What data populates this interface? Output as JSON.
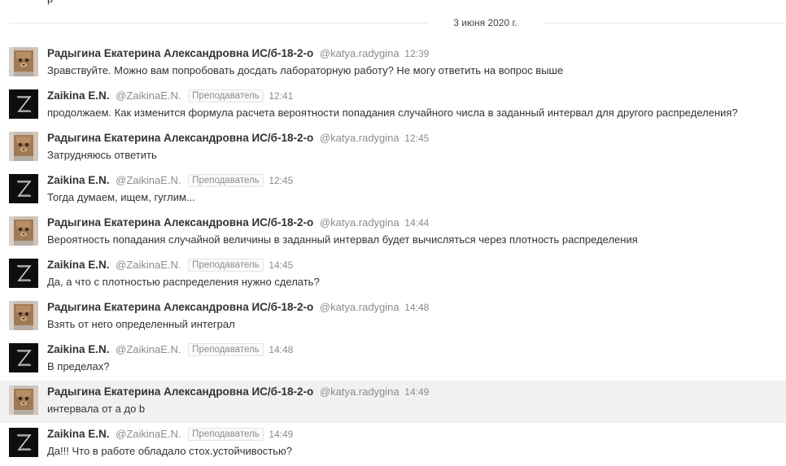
{
  "chat": {
    "top_fragment": "р",
    "date_separator": "3 июня 2020 г.",
    "users": {
      "student": {
        "name": "Радыгина Екатерина Александровна ИС/б-18-2-о",
        "username": "@katya.radygina"
      },
      "teacher": {
        "name": "Zaikina E.N.",
        "username": "@ZaikinaE.N.",
        "role": "Преподаватель"
      }
    },
    "messages": [
      {
        "time": "12:39",
        "text": "Зравствуйте. Можно вам попробовать досдать лабораторную работу? Не могу ответить на вопрос выше"
      },
      {
        "time": "12:41",
        "text": "продолжаем. Как изменится формула расчета вероятности попадания случайного числа в заданный интервал для другого распределения?"
      },
      {
        "time": "12:45",
        "text": "Затрудняюсь ответить"
      },
      {
        "time": "12:45",
        "text": "Тогда думаем, ищем, гуглим..."
      },
      {
        "time": "14:44",
        "text": "Вероятность попадания случайной величины в заданный интервал будет вычисляться через плотность распределения"
      },
      {
        "time": "14:45",
        "text": "Да, а что с плотностью распределения нужно сделать?"
      },
      {
        "time": "14:48",
        "text": "Взять от него определенный интеграл"
      },
      {
        "time": "14:48",
        "text": "В пределах?"
      },
      {
        "time": "14:49",
        "text": "интервала от a до b"
      },
      {
        "time": "14:49",
        "text": "Да!!! Что в работе обладало стох.устойчивостью?"
      }
    ]
  },
  "icons": {
    "student_avatar": "student-avatar-icon",
    "teacher_avatar": "teacher-avatar-icon"
  }
}
